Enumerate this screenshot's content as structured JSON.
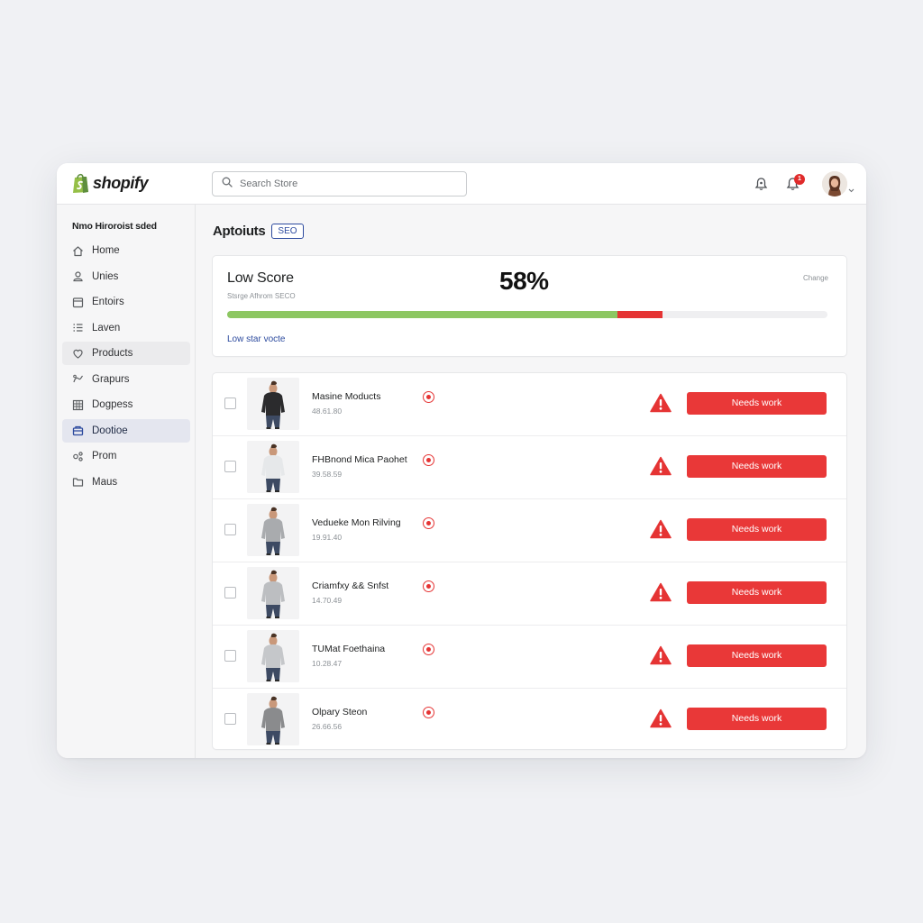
{
  "app": {
    "brand": "shopify",
    "search_placeholder": "Search Store",
    "notification_count": "1"
  },
  "sidebar": {
    "store_name": "Nmo Hiroroist sded",
    "items": [
      {
        "label": "Home",
        "icon": "home-icon"
      },
      {
        "label": "Unies",
        "icon": "user-icon"
      },
      {
        "label": "Entoirs",
        "icon": "orders-icon"
      },
      {
        "label": "Laven",
        "icon": "list-icon"
      },
      {
        "label": "Products",
        "icon": "tag-icon"
      },
      {
        "label": "Grapurs",
        "icon": "analytics-icon"
      },
      {
        "label": "Dogpess",
        "icon": "grid-icon"
      },
      {
        "label": "Dootioe",
        "icon": "store-icon"
      },
      {
        "label": "Prom",
        "icon": "marketing-icon"
      },
      {
        "label": "Maus",
        "icon": "folder-icon"
      }
    ],
    "hover_index": 4,
    "active_index": 7
  },
  "main": {
    "title": "Aptoiuts",
    "tag": "SEO",
    "score": {
      "title": "Low Score",
      "subtitle": "Stsrge Afhrom SECO",
      "percent_label": "58%",
      "change_label": "Change",
      "link": "Low star vocte",
      "green_fraction": 0.65,
      "red_fraction": 0.075
    },
    "products": [
      {
        "name": "Masine Moducts",
        "sub": "48.61.80",
        "status": "Needs work",
        "shirt": "#2b2b2d"
      },
      {
        "name": "FHBnond Mica Paohet",
        "sub": "39.58.59",
        "status": "Needs work",
        "shirt": "#e6e8ea"
      },
      {
        "name": "Vedueke Mon Rilving",
        "sub": "19.91.40",
        "status": "Needs work",
        "shirt": "#a9abae"
      },
      {
        "name": "Criamfxy && Snfst",
        "sub": "14.70.49",
        "status": "Needs work",
        "shirt": "#bcbec1"
      },
      {
        "name": "TUMat Foethaina",
        "sub": "10.28.47",
        "status": "Needs work",
        "shirt": "#c5c7ca"
      },
      {
        "name": "Olpary Steon",
        "sub": "26.66.56",
        "status": "Needs work",
        "shirt": "#8a8b8d"
      }
    ]
  },
  "colors": {
    "accent_blue": "#2c4a9e",
    "needs_work_red": "#e93838",
    "progress_green": "#8dc762",
    "progress_red": "#e53434"
  }
}
